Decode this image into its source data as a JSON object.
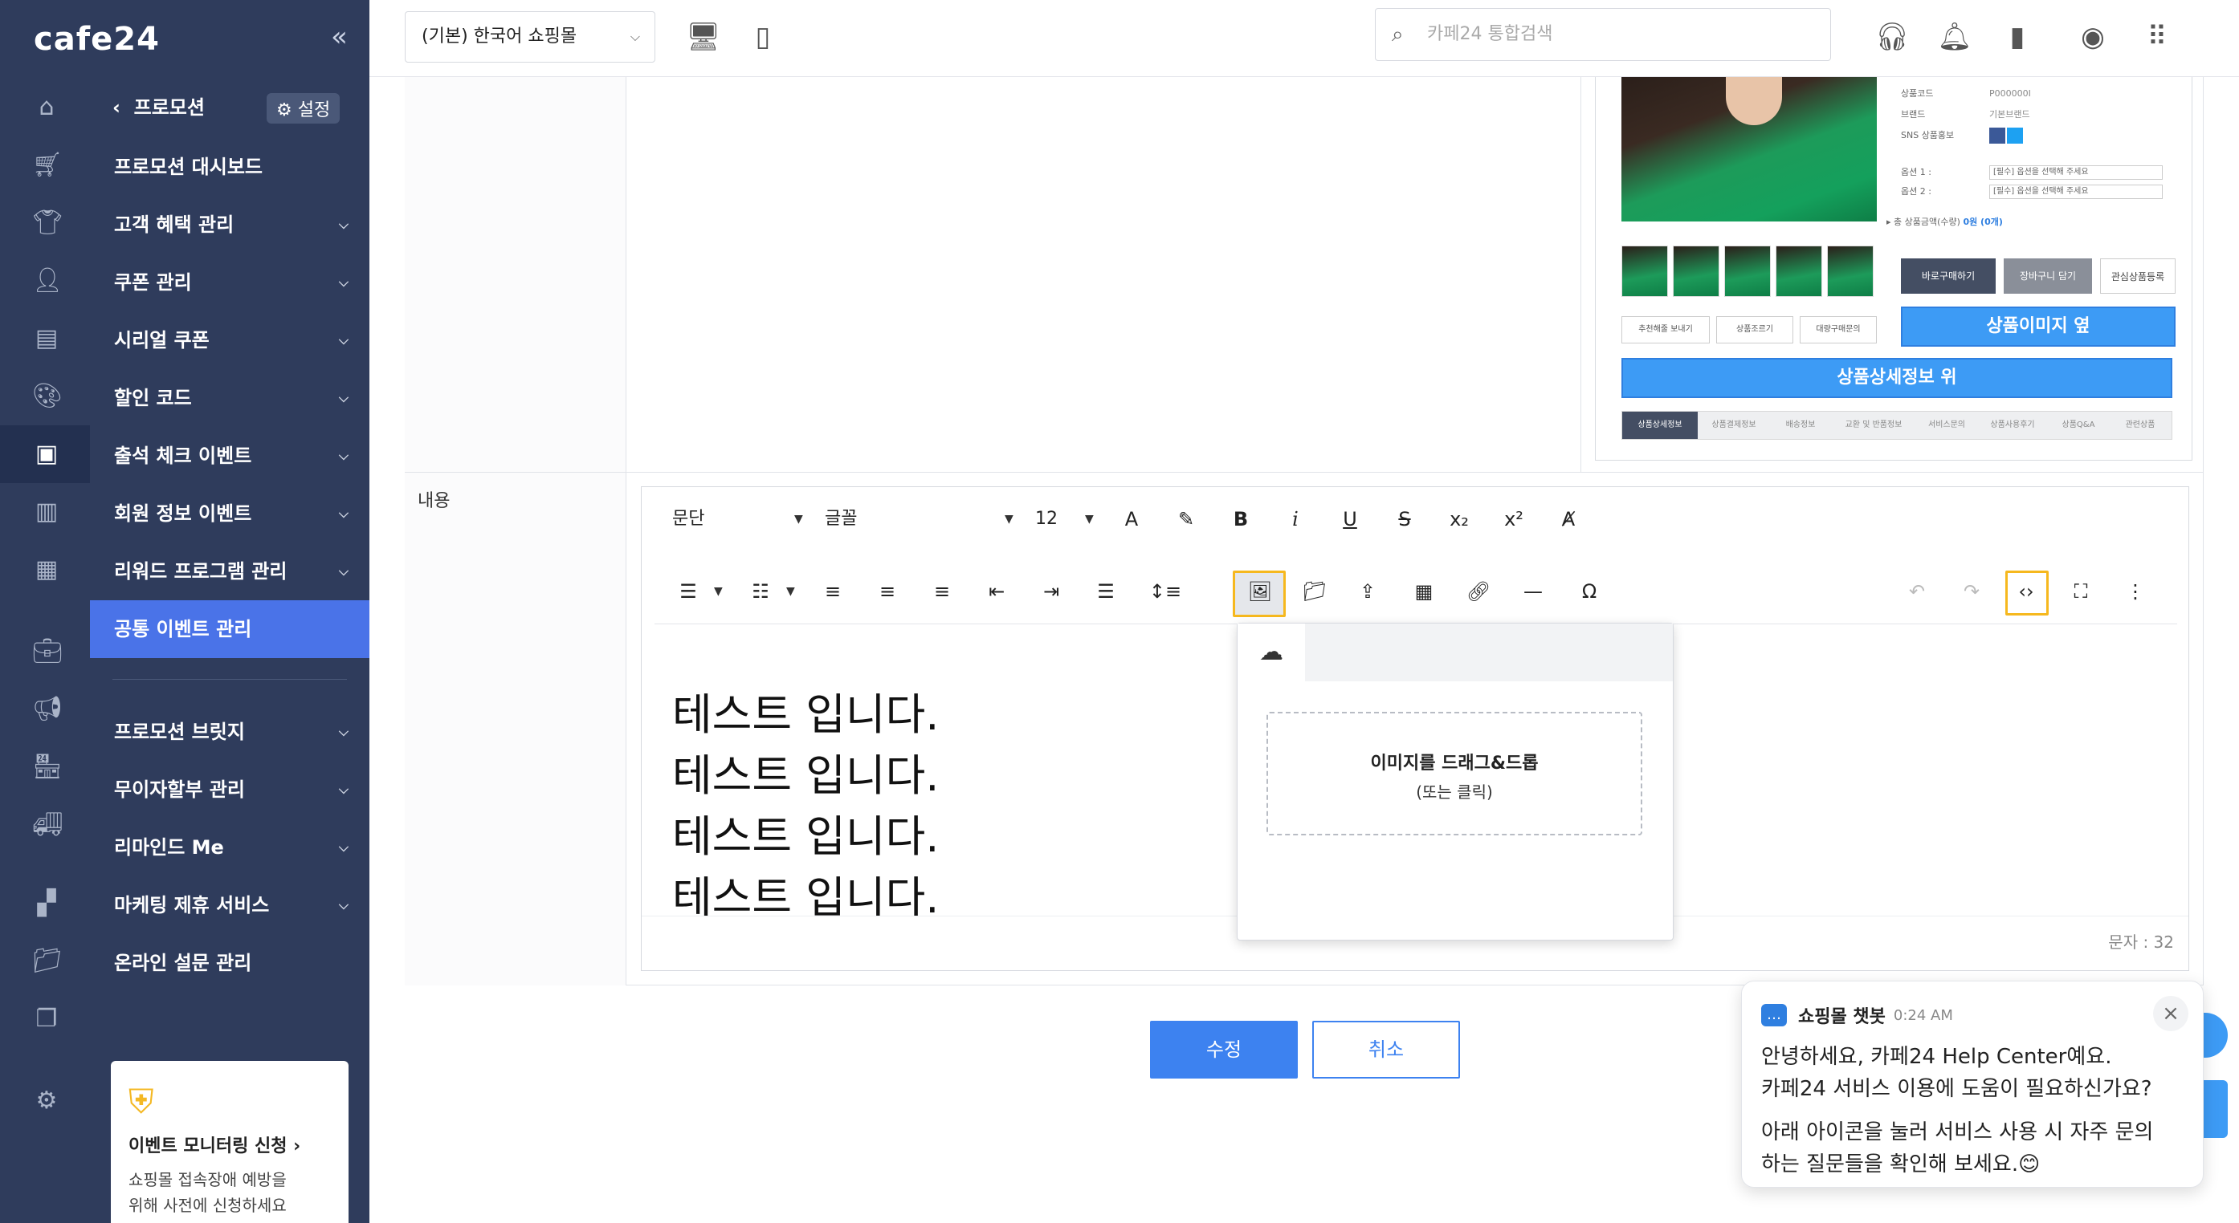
{
  "brand": {
    "logo": "cafe24",
    "collapse": "«"
  },
  "rail_icons": [
    "home-icon",
    "cart-icon",
    "shirt-icon",
    "person-icon",
    "document-icon",
    "palette-icon",
    "coupon-icon",
    "chart-icon",
    "excel-icon",
    "briefcase-icon",
    "megaphone-icon",
    "shop-icon",
    "truck-icon",
    "apps-add-icon",
    "folder-plus-icon",
    "copy-icon",
    "gear-icon"
  ],
  "nav": {
    "back_label": "프로모션",
    "settings_label": "설정",
    "items": [
      {
        "label": "프로모션 대시보드",
        "chevron": false
      },
      {
        "label": "고객 혜택 관리",
        "chevron": true
      },
      {
        "label": "쿠폰 관리",
        "chevron": true
      },
      {
        "label": "시리얼 쿠폰",
        "chevron": true
      },
      {
        "label": "할인 코드",
        "chevron": true
      },
      {
        "label": "출석 체크 이벤트",
        "chevron": true
      },
      {
        "label": "회원 정보 이벤트",
        "chevron": true
      },
      {
        "label": "리워드 프로그램 관리",
        "chevron": true
      },
      {
        "label": "공통 이벤트 관리",
        "chevron": false,
        "active": true
      }
    ],
    "items2": [
      {
        "label": "프로모션 브릿지",
        "chevron": true
      },
      {
        "label": "무이자할부 관리",
        "chevron": true
      },
      {
        "label": "리마인드 Me",
        "chevron": true
      },
      {
        "label": "마케팅 제휴 서비스",
        "chevron": true
      },
      {
        "label": "온라인 설문 관리",
        "chevron": false
      }
    ],
    "promo": {
      "title": "이벤트 모니터링 신청",
      "desc_line1": "쇼핑몰 접속장애 예방을",
      "desc_line2": "위해 사전에 신청하세요"
    }
  },
  "header": {
    "mall_select": "(기본) 한국어 쇼핑몰",
    "search_placeholder": "카페24 통합검색"
  },
  "form": {
    "content_label": "내용"
  },
  "preview": {
    "meta_labels": [
      "상품코드",
      "브랜드",
      "SNS 상품홍보"
    ],
    "meta_values": [
      "P000000I",
      "기본브랜드"
    ],
    "option1_label": "옵션 1 :",
    "option2_label": "옵션 2 :",
    "option_placeholder": "[필수] 옵션을 선택해 주세요",
    "total_label": "총 상품금액(수량)",
    "total_value": "0원 (0개)",
    "buy_now": "바로구매하기",
    "add_cart": "장바구니 담기",
    "wishlist": "관심상품등록",
    "small_buttons": [
      "추천해줄 보내기",
      "상품조르기",
      "대량구매문의"
    ],
    "side_banner": "상품이미지 옆",
    "top_banner": "상품상세정보 위",
    "tabs": [
      "상품상세정보",
      "상품결제정보",
      "배송정보",
      "교환 및 반품정보",
      "서비스문의",
      "상품사용후기",
      "상품Q&A",
      "관련상품"
    ]
  },
  "editor": {
    "paragraph": "문단",
    "font": "글꼴",
    "size": "12",
    "text_lines": [
      "테스트 입니다.",
      "테스트 입니다.",
      "테스트 입니다.",
      "테스트 입니다."
    ],
    "char_count": "문자 : 32"
  },
  "image_popup": {
    "drop_title": "이미지를 드래그&드롭",
    "drop_sub": "(또는 클릭)"
  },
  "buttons": {
    "save": "수정",
    "cancel": "취소"
  },
  "chatbot": {
    "name": "쇼핑몰 챗봇",
    "time": "0:24 AM",
    "msg1_line1": "안녕하세요, 카페24 Help Center예요.",
    "msg1_line2": "카페24 서비스 이용에 도움이 필요하신가요?",
    "msg2_line1": "아래 아이콘을 눌러 서비스 사용 시 자주 문의",
    "msg2_line2": "하는 질문들을 확인해 보세요.😊"
  },
  "colors": {
    "sidebar": "#2f3c5c",
    "accent": "#4a73e8",
    "primary_button": "#3d82f0",
    "highlight": "#f6b81e"
  }
}
